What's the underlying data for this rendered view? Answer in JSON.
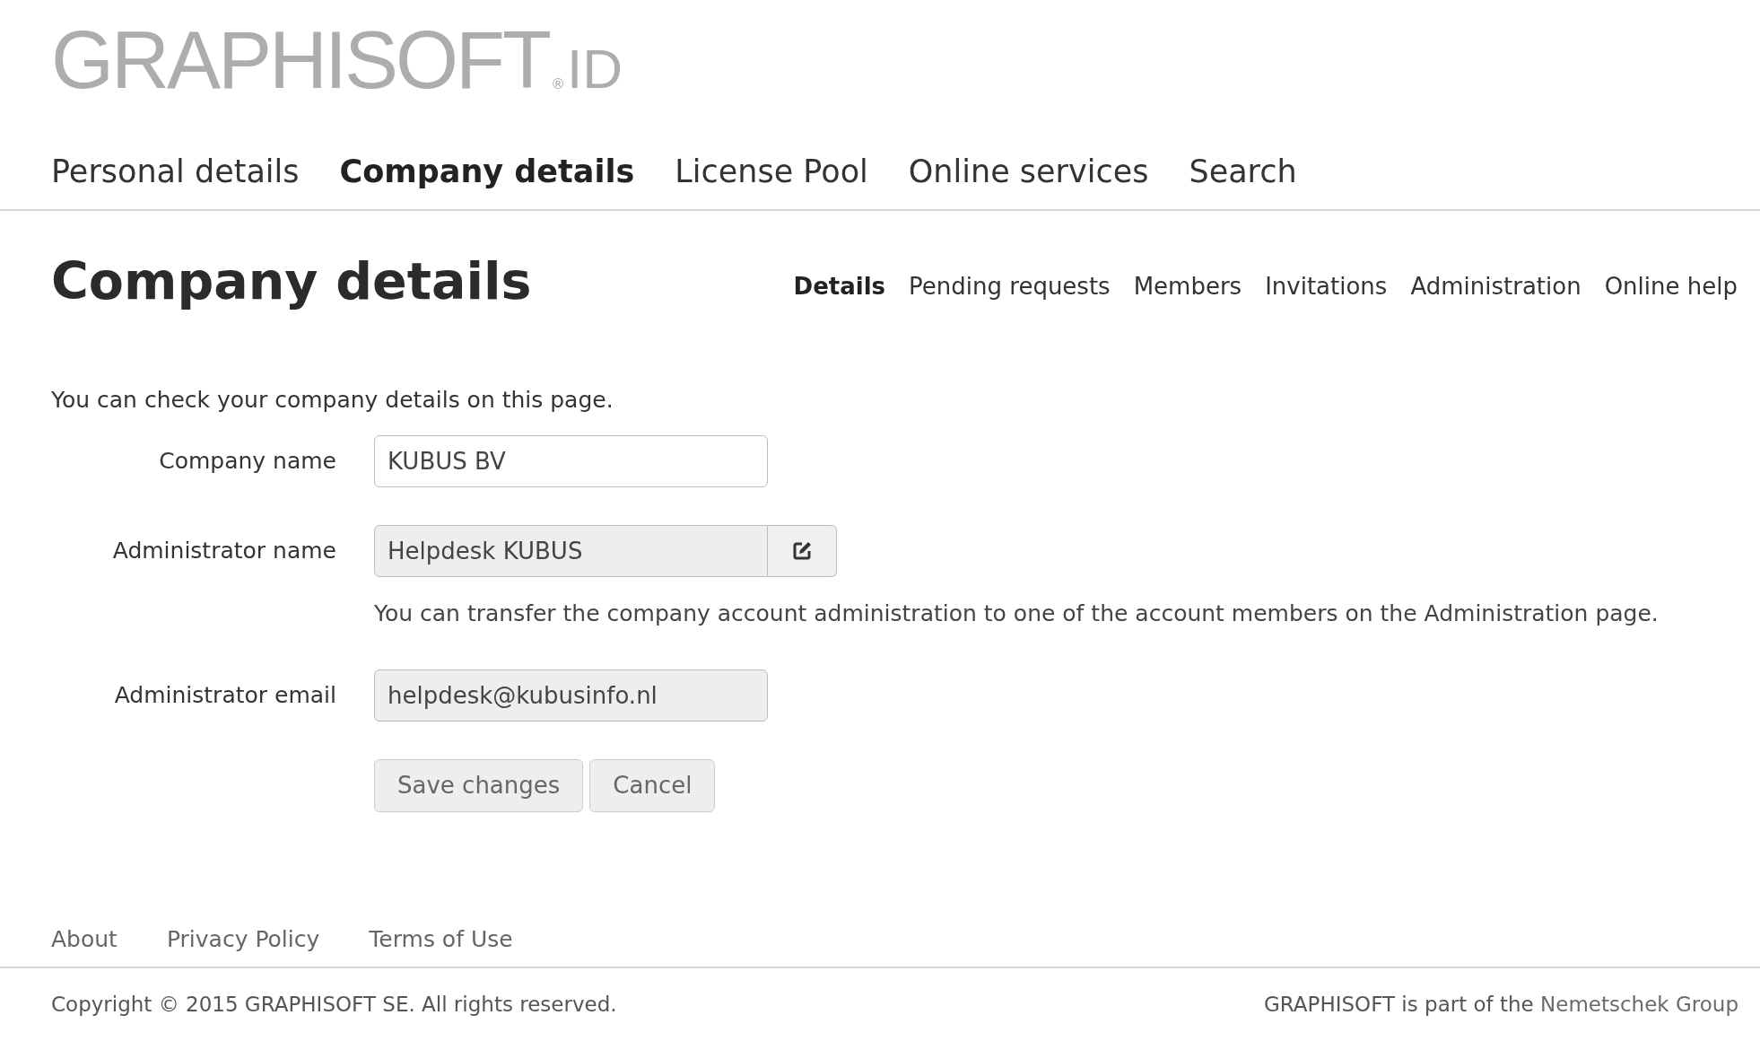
{
  "logo": {
    "name": "GRAPHISOFT",
    "mark": "®",
    "suffix": "ID"
  },
  "main_nav": [
    {
      "label": "Personal details",
      "selected": false
    },
    {
      "label": "Company details",
      "selected": true
    },
    {
      "label": "License Pool",
      "selected": false
    },
    {
      "label": "Online services",
      "selected": false
    },
    {
      "label": "Search",
      "selected": false
    }
  ],
  "page_title": "Company details",
  "sub_nav": [
    {
      "label": "Details",
      "selected": true
    },
    {
      "label": "Pending requests",
      "selected": false
    },
    {
      "label": "Members",
      "selected": false
    },
    {
      "label": "Invitations",
      "selected": false
    },
    {
      "label": "Administration",
      "selected": false
    },
    {
      "label": "Online help",
      "selected": false
    }
  ],
  "intro": "You can check your company details on this page.",
  "fields": [
    {
      "label": "Company name",
      "value": "KUBUS BV",
      "disabled": false,
      "editable_button": false
    },
    {
      "label": "Administrator name",
      "value": "Helpdesk KUBUS",
      "disabled": true,
      "editable_button": true,
      "help": "You can transfer the company account administration to one of the account members on the Administration page."
    },
    {
      "label": "Administrator email",
      "value": "helpdesk@kubusinfo.nl",
      "disabled": true,
      "editable_button": false
    }
  ],
  "buttons": [
    "Save changes",
    "Cancel"
  ],
  "footer_links": [
    "About",
    "Privacy Policy",
    "Terms of Use"
  ],
  "copyright": "Copyright © 2015 GRAPHISOFT SE. All rights reserved.",
  "group_note": {
    "text": "GRAPHISOFT is part of the",
    "link": "Nemetschek Group"
  }
}
